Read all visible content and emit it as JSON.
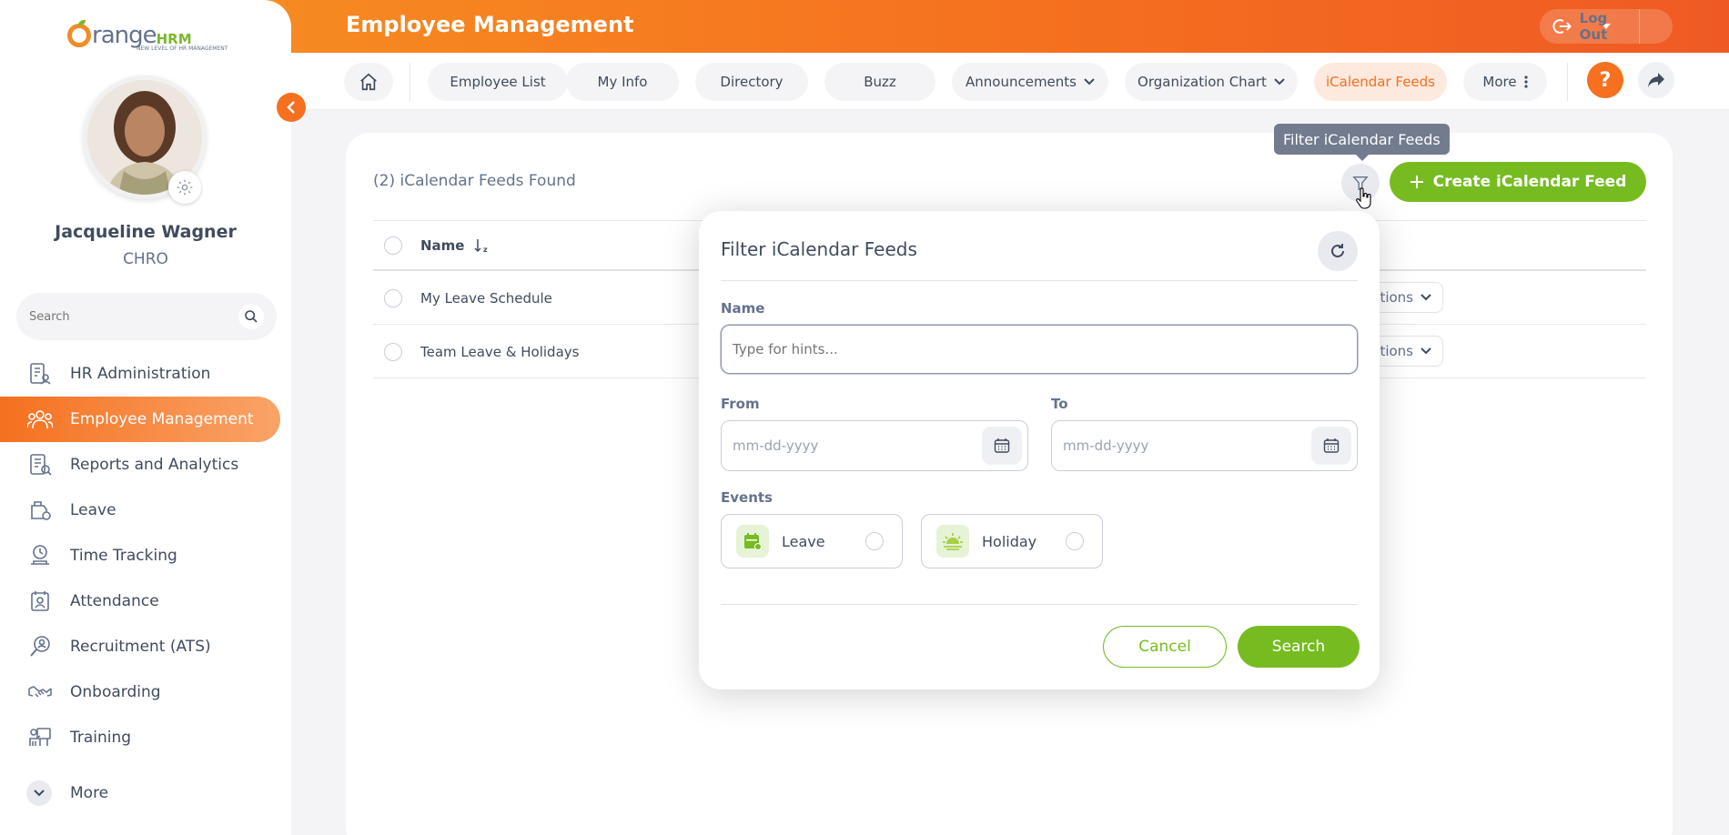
{
  "brand": {
    "logo_text": "range",
    "logo_hrm": "HRM",
    "logo_tagline": "NEW LEVEL OF HR MANAGEMENT"
  },
  "user": {
    "name": "Jacqueline Wagner",
    "role": "CHRO"
  },
  "sidebar": {
    "search_placeholder": "Search",
    "items": [
      {
        "label": "HR Administration",
        "icon": "hr-admin-icon"
      },
      {
        "label": "Employee Management",
        "icon": "employee-management-icon",
        "active": true
      },
      {
        "label": "Reports and Analytics",
        "icon": "reports-icon"
      },
      {
        "label": "Leave",
        "icon": "leave-icon"
      },
      {
        "label": "Time Tracking",
        "icon": "time-tracking-icon"
      },
      {
        "label": "Attendance",
        "icon": "attendance-icon"
      },
      {
        "label": "Recruitment (ATS)",
        "icon": "recruitment-icon"
      },
      {
        "label": "Onboarding",
        "icon": "onboarding-icon"
      },
      {
        "label": "Training",
        "icon": "training-icon"
      }
    ],
    "more_label": "More"
  },
  "header": {
    "title": "Employee Management",
    "logout_label": "Log Out"
  },
  "nav": {
    "tabs": [
      {
        "label": "Employee List"
      },
      {
        "label": "My Info"
      },
      {
        "label": "Directory"
      },
      {
        "label": "Buzz"
      },
      {
        "label": "Announcements"
      },
      {
        "label": "Organization Chart"
      },
      {
        "label": "iCalendar Feeds",
        "active": true
      },
      {
        "label": "More"
      }
    ],
    "help_label": "?"
  },
  "main": {
    "found_text": "(2) iCalendar Feeds Found",
    "create_label": "Create iCalendar Feed",
    "tooltip": "Filter iCalendar Feeds",
    "table": {
      "name_header": "Name",
      "rows": [
        {
          "name": "My Leave Schedule",
          "actions": "ctions"
        },
        {
          "name": "Team Leave & Holidays",
          "actions": "ctions"
        }
      ]
    }
  },
  "filter_panel": {
    "title": "Filter iCalendar Feeds",
    "name_label": "Name",
    "name_placeholder": "Type for hints...",
    "from_label": "From",
    "from_placeholder": "mm-dd-yyyy",
    "to_label": "To",
    "to_placeholder": "mm-dd-yyyy",
    "events_label": "Events",
    "events": [
      {
        "label": "Leave",
        "icon": "leave-event-icon"
      },
      {
        "label": "Holiday",
        "icon": "holiday-event-icon"
      }
    ],
    "cancel_label": "Cancel",
    "search_label": "Search"
  },
  "colors": {
    "accent": "#f5701f",
    "primary_green": "#76bc21",
    "text": "#404b5e"
  }
}
